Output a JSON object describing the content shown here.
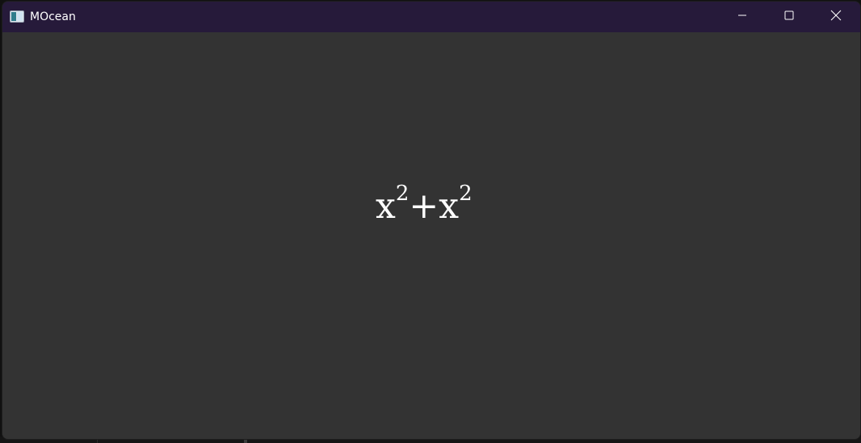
{
  "window": {
    "title": "MOcean",
    "icon": "app-window-icon"
  },
  "controls": {
    "minimize_icon": "minimize-icon",
    "maximize_icon": "maximize-icon",
    "close_icon": "close-icon"
  },
  "formula": {
    "term1_base": "x",
    "term1_exponent": "2",
    "operator": "+",
    "term2_base": "x",
    "term2_exponent": "2"
  },
  "colors": {
    "titlebar": "#261a3a",
    "background": "#333333",
    "text": "#ffffff"
  }
}
